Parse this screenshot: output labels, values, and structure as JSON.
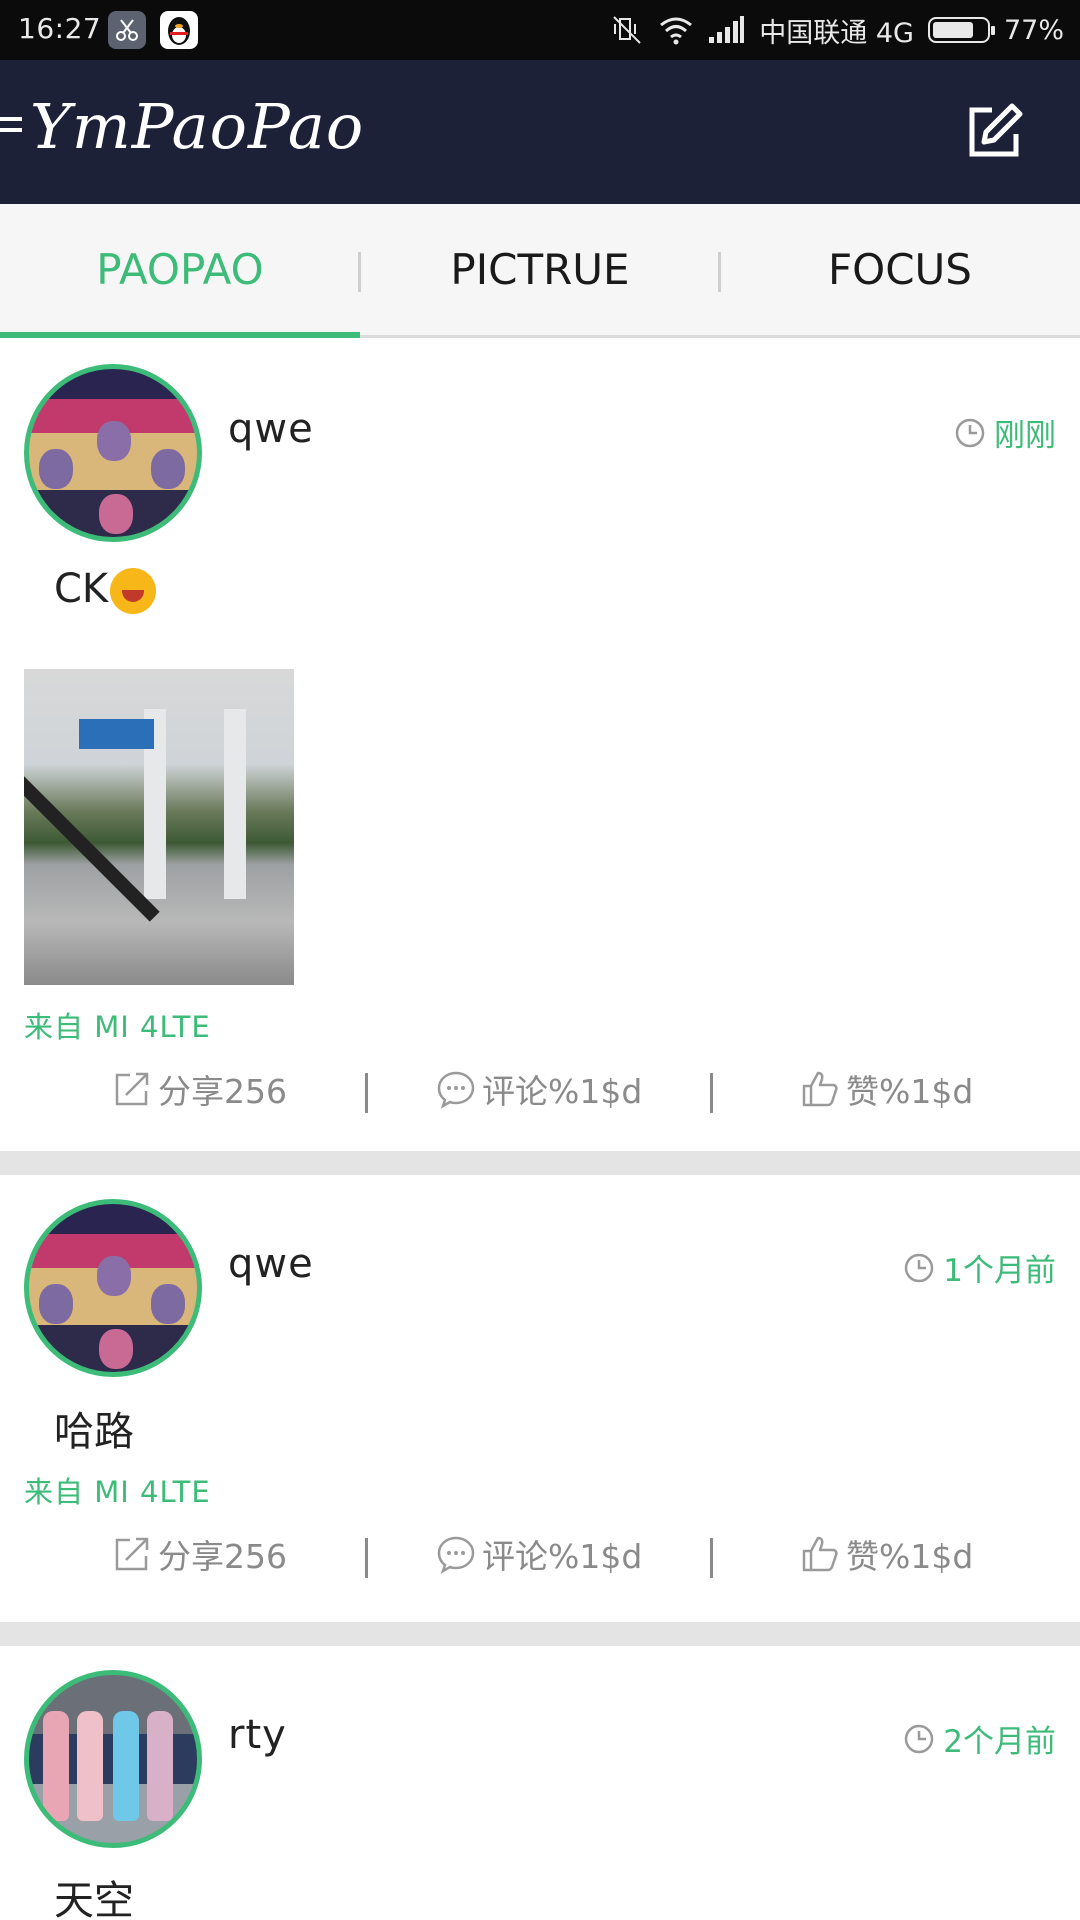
{
  "status_bar": {
    "time": "16:27",
    "carrier": "中国联通 4G",
    "battery": "77%",
    "battery_level": 0.77
  },
  "toolbar": {
    "title": "YmPaoPao",
    "menu_icon": "menu-icon",
    "edit_icon": "edit-icon"
  },
  "tabs": [
    {
      "label": "PAOPAO",
      "active": true
    },
    {
      "label": "PICTRUE",
      "active": false
    },
    {
      "label": "FOCUS",
      "active": false
    }
  ],
  "posts": [
    {
      "username": "qwe",
      "time": "刚刚",
      "text": "CK",
      "has_emoji": true,
      "has_photo": true,
      "source": "来自  MI  4LTE",
      "share": "分享256",
      "comment": "评论%1$d",
      "like": "赞%1$d"
    },
    {
      "username": "qwe",
      "time": "1个月前",
      "text": "哈路",
      "has_photo": false,
      "source": "来自  MI  4LTE",
      "share": "分享256",
      "comment": "评论%1$d",
      "like": "赞%1$d"
    },
    {
      "username": "rty",
      "time": "2个月前",
      "text": "天空"
    }
  ],
  "colors": {
    "accent": "#3dbb78",
    "toolbar": "#1c2138",
    "status_bar": "#0b0b0b",
    "separator": "#e4e4e4"
  }
}
